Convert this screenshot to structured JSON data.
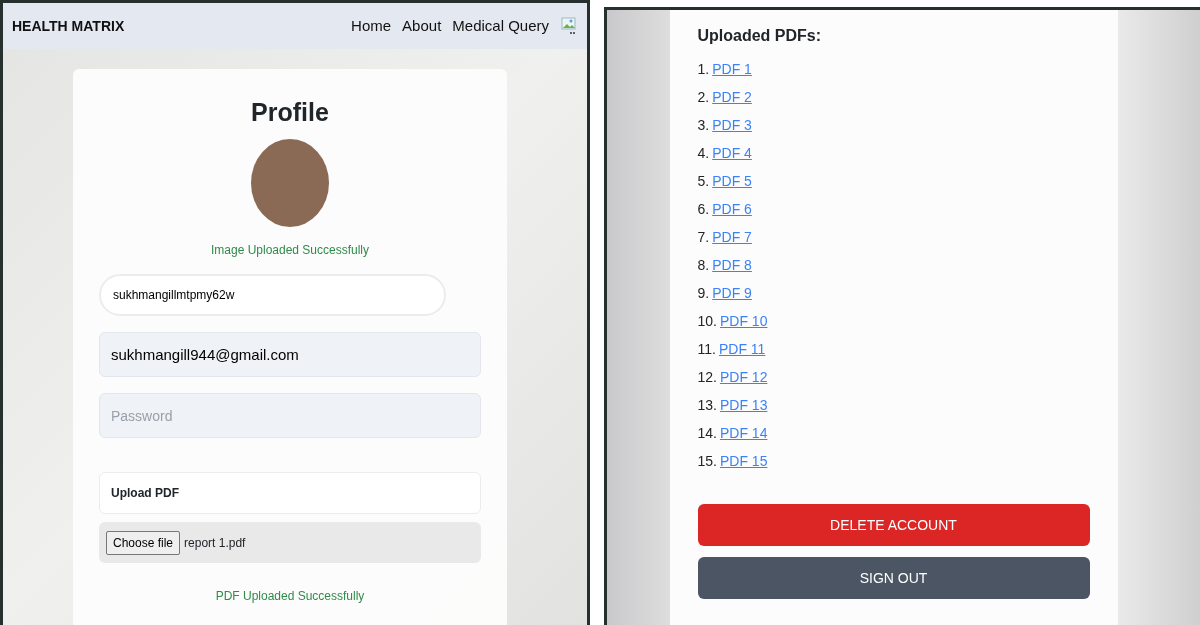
{
  "profile_screen": {
    "navbar": {
      "brand": "HEALTH MATRIX",
      "links": [
        "Home",
        "About",
        "Medical Query"
      ]
    },
    "title": "Profile",
    "image_status": "Image Uploaded Successfully",
    "username": {
      "value": "sukhmangillmtpmy62w"
    },
    "email": {
      "value": "sukhmangill944@gmail.com"
    },
    "password": {
      "placeholder": "Password"
    },
    "upload_label": "Upload PDF",
    "file_input": {
      "button": "Choose file",
      "file_name": "report 1.pdf"
    },
    "pdf_status": "PDF Uploaded Successfully"
  },
  "pdfs_screen": {
    "heading": "Uploaded PDFs:",
    "pdfs": [
      {
        "number": "1.",
        "label": "PDF 1"
      },
      {
        "number": "2.",
        "label": "PDF 2"
      },
      {
        "number": "3.",
        "label": "PDF 3"
      },
      {
        "number": "4.",
        "label": "PDF 4"
      },
      {
        "number": "5.",
        "label": "PDF 5"
      },
      {
        "number": "6.",
        "label": "PDF 6"
      },
      {
        "number": "7.",
        "label": "PDF 7"
      },
      {
        "number": "8.",
        "label": "PDF 8"
      },
      {
        "number": "9.",
        "label": "PDF 9"
      },
      {
        "number": "10.",
        "label": "PDF 10"
      },
      {
        "number": "11.",
        "label": "PDF 11"
      },
      {
        "number": "12.",
        "label": "PDF 12"
      },
      {
        "number": "13.",
        "label": "PDF 13"
      },
      {
        "number": "14.",
        "label": "PDF 14"
      },
      {
        "number": "15.",
        "label": "PDF 15"
      }
    ],
    "buttons": [
      {
        "kind": "danger",
        "label": "DELETE ACCOUNT"
      },
      {
        "kind": "secondary",
        "label": "SIGN OUT"
      }
    ]
  }
}
